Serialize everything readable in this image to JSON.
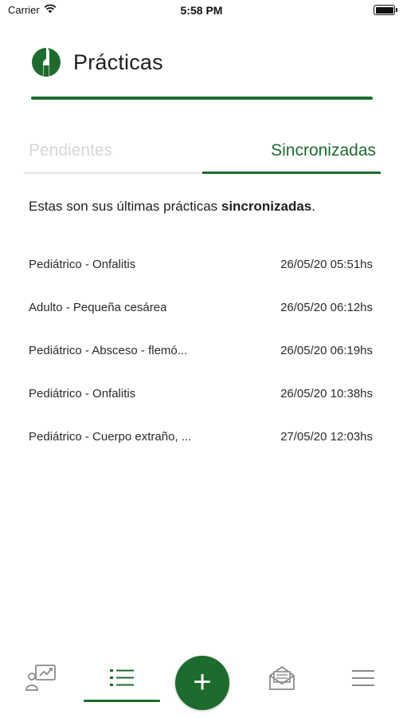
{
  "status_bar": {
    "carrier": "Carrier",
    "time": "5:58 PM",
    "battery_level": 1.0
  },
  "header": {
    "title": "Prácticas",
    "logo_icon": "app-logo-icon"
  },
  "tabs": [
    {
      "label": "Pendientes",
      "active": false
    },
    {
      "label": "Sincronizadas",
      "active": true
    }
  ],
  "intro": {
    "text_before": "Estas son sus últimas prácticas ",
    "text_bold": "sincronizadas",
    "text_after": "."
  },
  "practices": [
    {
      "name": "Pediátrico - Onfalitis",
      "date": "26/05/20 05:51hs"
    },
    {
      "name": "Adulto - Pequeña cesárea",
      "date": "26/05/20 06:12hs"
    },
    {
      "name": "Pediátrico - Absceso - flemó...",
      "date": "26/05/20 06:19hs"
    },
    {
      "name": "Pediátrico - Onfalitis",
      "date": "26/05/20 10:38hs"
    },
    {
      "name": "Pediátrico - Cuerpo extraño, ...",
      "date": "27/05/20 12:03hs"
    }
  ],
  "bottom_nav": {
    "items": [
      {
        "icon": "presentation-icon",
        "active": false
      },
      {
        "icon": "list-icon",
        "active": true
      },
      {
        "icon": "plus-icon",
        "label": "+",
        "active": false
      },
      {
        "icon": "mail-icon",
        "active": false
      },
      {
        "icon": "menu-icon",
        "active": false
      }
    ]
  },
  "colors": {
    "brand_green": "#1e6b2e",
    "inactive_tab": "#d6d6d6",
    "icon_gray": "#8a8a8a"
  }
}
